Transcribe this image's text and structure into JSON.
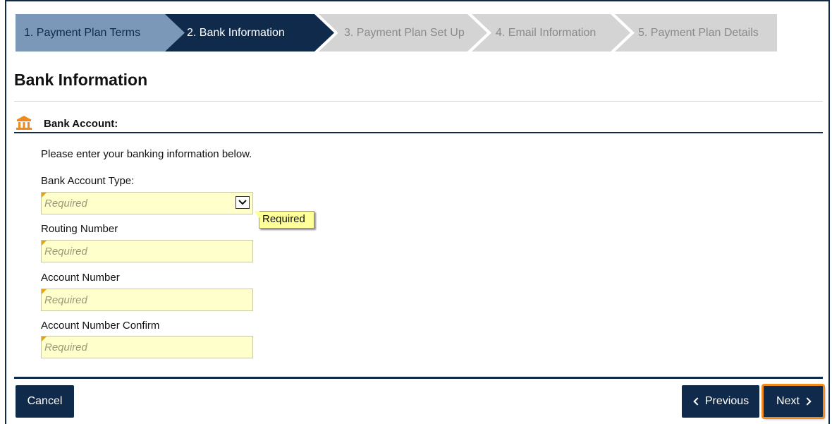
{
  "wizard": {
    "steps": [
      {
        "label": "1. Payment Plan Terms",
        "state": "completed"
      },
      {
        "label": "2. Bank Information",
        "state": "active"
      },
      {
        "label": "3. Payment Plan Set Up",
        "state": "pending"
      },
      {
        "label": "4. Email Information",
        "state": "pending"
      },
      {
        "label": "5. Payment Plan Details",
        "state": "pending"
      }
    ]
  },
  "page": {
    "title": "Bank Information"
  },
  "section": {
    "icon": "bank-icon",
    "label": "Bank Account:",
    "intro": "Please enter your banking information below."
  },
  "form": {
    "account_type": {
      "label": "Bank Account Type:",
      "placeholder": "Required"
    },
    "routing_number": {
      "label": "Routing Number",
      "placeholder": "Required"
    },
    "account_number": {
      "label": "Account Number",
      "placeholder": "Required"
    },
    "account_number_confirm": {
      "label": "Account Number Confirm",
      "placeholder": "Required"
    },
    "tooltip": "Required"
  },
  "footer": {
    "cancel_label": "Cancel",
    "previous_label": "Previous",
    "next_label": "Next"
  },
  "colors": {
    "navy": "#0f2a4a",
    "completed_step": "#7b98b8",
    "pending_step": "#d4d4d4",
    "field_bg": "#ffffcc",
    "required_marker": "#f0a000",
    "focus_outline": "#f08a1c"
  }
}
